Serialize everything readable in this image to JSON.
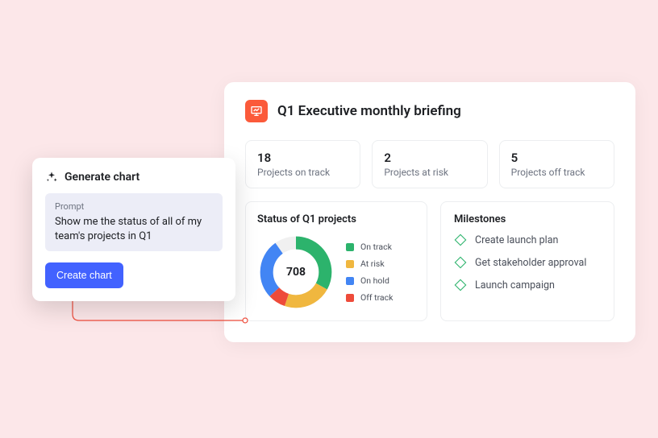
{
  "dashboard": {
    "title": "Q1 Executive monthly briefing",
    "stats": [
      {
        "value": "18",
        "label": "Projects on track"
      },
      {
        "value": "2",
        "label": "Projects at risk"
      },
      {
        "value": "5",
        "label": "Projects off track"
      }
    ],
    "chart_card_title": "Status of Q1 projects",
    "milestones_title": "Milestones",
    "milestones": [
      {
        "label": "Create launch plan"
      },
      {
        "label": "Get stakeholder approval"
      },
      {
        "label": "Launch campaign"
      }
    ]
  },
  "generate_panel": {
    "heading": "Generate chart",
    "prompt_label": "Prompt",
    "prompt_text": "Show me the status of all of my team's projects in Q1",
    "button": "Create chart"
  },
  "chart_data": {
    "type": "pie",
    "title": "Status of Q1 projects",
    "center_value": "708",
    "series": [
      {
        "name": "On track",
        "value": 33,
        "color": "#2cb36c"
      },
      {
        "name": "At risk",
        "value": 22,
        "color": "#f0b73f"
      },
      {
        "name": "On hold",
        "value": 27,
        "color": "#4285f4"
      },
      {
        "name": "Off track",
        "value": 8,
        "color": "#ee4b3a"
      }
    ]
  }
}
